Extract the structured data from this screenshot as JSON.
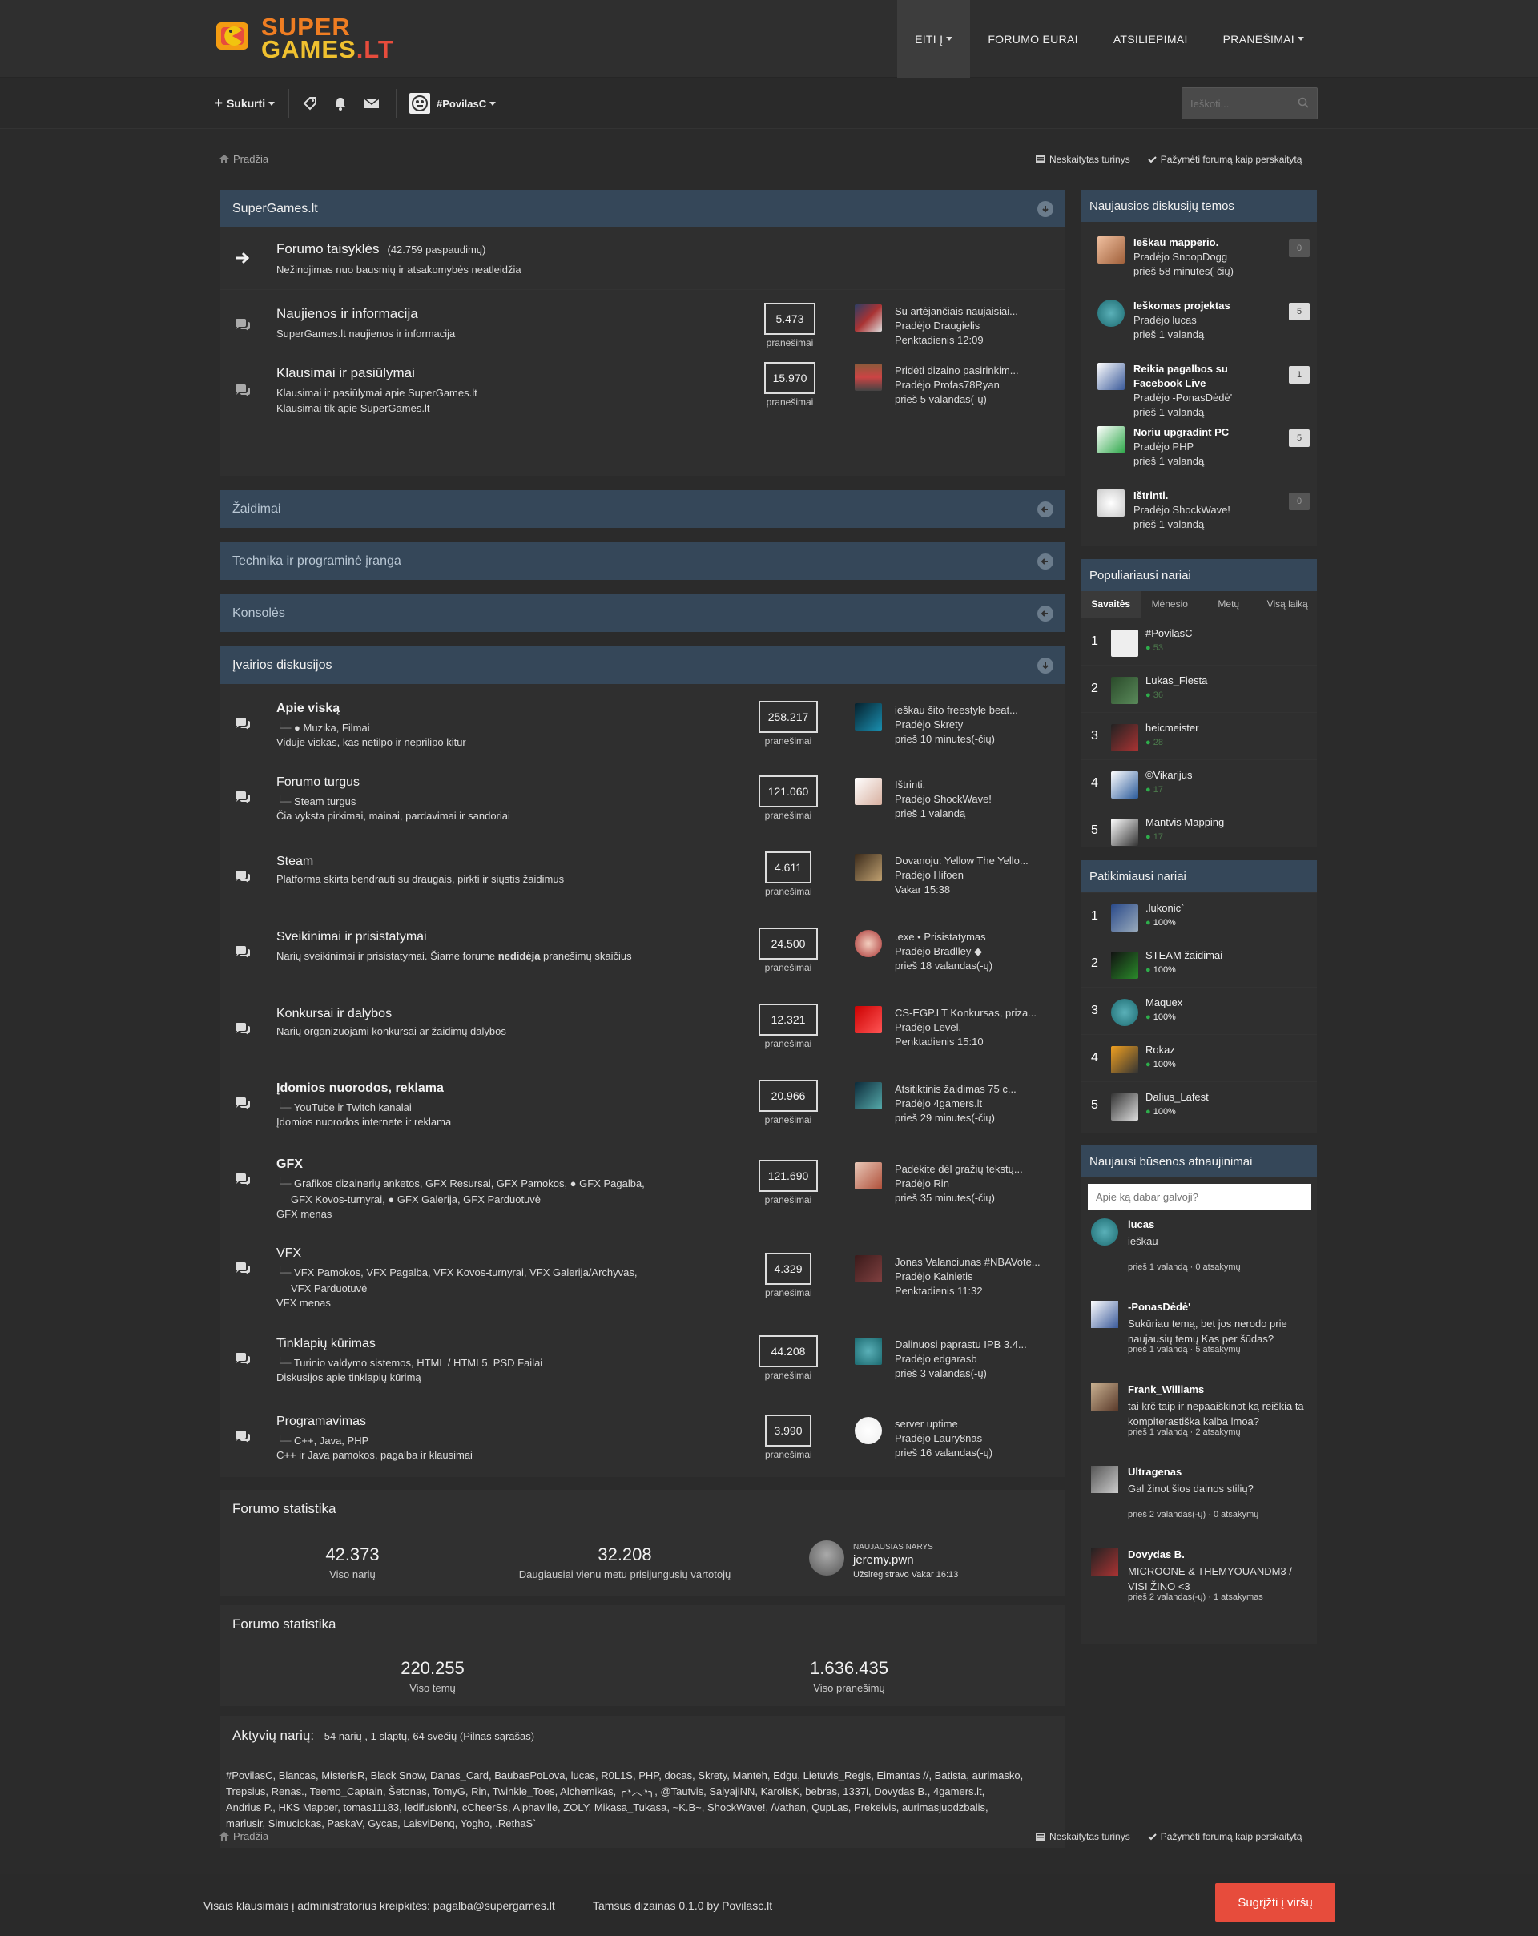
{
  "header": {
    "logo_line1": "SUPER",
    "logo_line2a": "GAMES",
    "logo_line2b": ".LT",
    "nav": [
      {
        "label": "EITI Į"
      },
      {
        "label": "FORUMO EURAI"
      },
      {
        "label": "ATSILIEPIMAI"
      },
      {
        "label": "PRANEŠIMAI"
      }
    ]
  },
  "userbar": {
    "create_label": "Sukurti",
    "username": "#PovilasC",
    "search_placeholder": "Ieškoti..."
  },
  "breadcrumb": {
    "home": "Pradžia",
    "unread": "Neskaitytas turinys",
    "mark_read": "Pažymėti forumą kaip perskaitytą"
  },
  "categories": [
    {
      "name": "SuperGames.lt",
      "forums": [
        {
          "title": "Forumo taisyklės",
          "views": "(42.759 paspaudimų)",
          "desc": "Nežinojimas nuo bausmių ir atsakomybės neatleidžia"
        },
        {
          "title": "Naujienos ir informacija",
          "desc": "SuperGames.lt naujienos ir informacija",
          "count": "5.473",
          "count_label": "pranešimai",
          "last_title": "Su artėjančiais naujaisiai...",
          "last_by": "Pradėjo Draugielis",
          "last_time": "Penktadienis 12:09"
        },
        {
          "title": "Klausimai ir pasiūlymai",
          "desc": "Klausimai ir pasiūlymai apie SuperGames.lt",
          "desc2": "Klausimai tik apie SuperGames.lt",
          "count": "15.970",
          "count_label": "pranešimai",
          "last_title": "Pridėti dizaino pasirinkim...",
          "last_by": "Pradėjo Profas78Ryan",
          "last_time": "prieš 5 valandas(-ų)"
        }
      ]
    },
    {
      "name": "Žaidimai"
    },
    {
      "name": "Technika ir programinė įranga"
    },
    {
      "name": "Konsolės"
    },
    {
      "name": "Įvairios diskusijos",
      "forums": [
        {
          "title": "Apie viską",
          "subs": "● Muzika,  Filmai",
          "desc": "Viduje viskas, kas netilpo ir neprilipo kitur",
          "count": "258.217",
          "count_label": "pranešimai",
          "last_title": "ieškau šito freestyle beat...",
          "last_by": "Pradėjo Skrety",
          "last_time": "prieš 10 minutes(-čių)"
        },
        {
          "title": "Forumo turgus",
          "subs": "Steam turgus",
          "desc": "Čia vyksta pirkimai, mainai, pardavimai ir sandoriai",
          "count": "121.060",
          "count_label": "pranešimai",
          "last_title": "Ištrinti.",
          "last_by": "Pradėjo ShockWave!",
          "last_time": "prieš 1 valandą"
        },
        {
          "title": "Steam",
          "desc": "Platforma skirta bendrauti su draugais, pirkti ir siųstis žaidimus",
          "count": "4.611",
          "count_label": "pranešimai",
          "last_title": "Dovanoju: Yellow The Yello...",
          "last_by": "Pradėjo Hifoen",
          "last_time": "Vakar 15:38"
        },
        {
          "title": "Sveikinimai ir prisistatymai",
          "desc_a": "Narių sveikinimai ir prisistatymai. Šiame forume ",
          "desc_b": "nedidėja",
          "desc_c": " pranešimų skaičius",
          "count": "24.500",
          "count_label": "pranešimai",
          "last_title": ".exe • Prisistatymas",
          "last_by": "Pradėjo Bradlley ◆",
          "last_time": "prieš 18 valandas(-ų)"
        },
        {
          "title": "Konkursai ir dalybos",
          "desc": "Narių organizuojami konkursai ar žaidimų dalybos",
          "count": "12.321",
          "count_label": "pranešimai",
          "last_title": "CS-EGP.LT Konkursas, priza...",
          "last_by": "Pradėjo Level.",
          "last_time": "Penktadienis 15:10"
        },
        {
          "title": "Įdomios nuorodos, reklama",
          "subs": "YouTube ir Twitch kanalai",
          "desc": "Įdomios nuorodos internete ir reklama",
          "count": "20.966",
          "count_label": "pranešimai",
          "last_title": "Atsitiktinis žaidimas 75 c...",
          "last_by": "Pradėjo 4gamers.lt",
          "last_time": "prieš 29 minutes(-čių)"
        },
        {
          "title": "GFX",
          "subs": "Grafikos dizainerių anketos,  GFX Resursai,  GFX Pamokos,  ● GFX Pagalba,",
          "subs2": "GFX Kovos-turnyrai,  ● GFX Galerija,  GFX Parduotuvė",
          "desc": "GFX menas",
          "count": "121.690",
          "count_label": "pranešimai",
          "last_title": "Padėkite dėl gražių tekstų...",
          "last_by": "Pradėjo Rin",
          "last_time": "prieš 35 minutes(-čių)"
        },
        {
          "title": "VFX",
          "subs": "VFX Pamokos,  VFX Pagalba,  VFX Kovos-turnyrai,  VFX Galerija/Archyvas,",
          "subs2": "VFX Parduotuvė",
          "desc": "VFX menas",
          "count": "4.329",
          "count_label": "pranešimai",
          "last_title": "Jonas Valanciunas #NBAVote...",
          "last_by": "Pradėjo Kalnietis",
          "last_time": "Penktadienis 11:32"
        },
        {
          "title": "Tinklapių kūrimas",
          "subs": "Turinio valdymo sistemos,  HTML / HTML5,  PSD Failai",
          "desc": "Diskusijos apie tinklapių kūrimą",
          "count": "44.208",
          "count_label": "pranešimai",
          "last_title": "Dalinuosi paprastu IPB 3.4...",
          "last_by": "Pradėjo edgarasb",
          "last_time": "prieš 3 valandas(-ų)"
        },
        {
          "title": "Programavimas",
          "subs": "C++,  Java,  PHP",
          "desc": "C++ ir Java pamokos, pagalba ir klausimai",
          "count": "3.990",
          "count_label": "pranešimai",
          "last_title": "server uptime",
          "last_by": "Pradėjo Laury8nas",
          "last_time": "prieš 16 valandas(-ų)"
        }
      ]
    }
  ],
  "stats1": {
    "title": "Forumo statistika",
    "members": "42.373",
    "members_label": "Viso narių",
    "max_online": "32.208",
    "max_online_label": "Daugiausiai vienu metu prisijungusių vartotojų",
    "newest_label": "NAUJAUSIAS NARYS",
    "newest_name": "jeremy.pwn",
    "newest_time": "Užsiregistravo Vakar 16:13"
  },
  "stats2": {
    "title": "Forumo statistika",
    "topics": "220.255",
    "topics_label": "Viso temų",
    "posts": "1.636.435",
    "posts_label": "Viso pranešimų"
  },
  "active": {
    "title": "Aktyvių narių:",
    "summary": "54 narių , 1 slaptų, 64 svečių (Pilnas sąrašas)",
    "line1": "#PovilasC, Blancas, MisterisR, Black Snow, Danas_Card, BaubasPoLova, lucas, R0L1S, PHP, docas, Skrety, Manteh, Edgu, Lietuvis_Regis, Eimantas //, Batista, aurimasko,",
    "line2": "Trepsius, Renas., Teemo_Captain, Šetonas, TomyG, Rin, Twinkle_Toes, Alchemikas, ╭◔︿◔╮, @Tautvis, SaiyajiNN, KarolisK, bebras, 1337i, Dovydas B., 4gamers.lt,",
    "line3": "Andrius P., HKS Mapper, tomas11183, ledifusionN, cCheerSs, Alphaville, ZOLY, Mikasa_Tukasa, ~K.B~, ShockWave!, /\\/athan, QupLas, Prekeivis, aurimasjuodzbalis,",
    "line4": "mariusir, Simuciokas, PaskaV, Gycas, LaisviDenq, Yogho, .RethaS`"
  },
  "sidebar": {
    "discussions_title": "Naujausios diskusijų temos",
    "discussions": [
      {
        "title": "Ieškau mapperio.",
        "by": "Pradėjo SnoopDogg",
        "time": "prieš 58 minutes(-čių)",
        "count": "0"
      },
      {
        "title": "Ieškomas projektas",
        "by": "Pradėjo lucas",
        "time": "prieš 1 valandą",
        "count": "5"
      },
      {
        "title": "Reikia pagalbos su",
        "title2": "Facebook Live",
        "by": "Pradėjo -PonasDėdė'",
        "time": "prieš 1 valandą",
        "count": "1"
      },
      {
        "title": "Noriu upgradint PC",
        "by": "Pradėjo PHP",
        "time": "prieš 1 valandą",
        "count": "5"
      },
      {
        "title": "Ištrinti.",
        "by": "Pradėjo ShockWave!",
        "time": "prieš 1 valandą",
        "count": "0"
      }
    ],
    "popular_title": "Populiariausi nariai",
    "popular_tabs": [
      "Savaitės",
      "Mėnesio",
      "Metų",
      "Visą laiką"
    ],
    "popular": [
      {
        "rank": "1",
        "name": "#PovilasC",
        "score": "53"
      },
      {
        "rank": "2",
        "name": "Lukas_Fiesta",
        "score": "36"
      },
      {
        "rank": "3",
        "name": "heicmeister",
        "score": "28"
      },
      {
        "rank": "4",
        "name": "©Vikarijus",
        "score": "17"
      },
      {
        "rank": "5",
        "name": "Mantvis Mapping",
        "score": "17"
      }
    ],
    "trusted_title": "Patikimiausi nariai",
    "trusted": [
      {
        "rank": "1",
        "name": ".lukonic`",
        "score": "100%"
      },
      {
        "rank": "2",
        "name": "STEAM žaidimai",
        "score": "100%"
      },
      {
        "rank": "3",
        "name": "Maquex",
        "score": "100%"
      },
      {
        "rank": "4",
        "name": "Rokaz",
        "score": "100%"
      },
      {
        "rank": "5",
        "name": "Dalius_Lafest",
        "score": "100%"
      }
    ],
    "status_title": "Naujausi būsenos atnaujinimai",
    "status_placeholder": "Apie ką dabar galvoji?",
    "statuses": [
      {
        "name": "lucas",
        "text": "ieškau",
        "meta": "prieš 1 valandą · 0 atsakymų"
      },
      {
        "name": "-PonasDėdė'",
        "text": "Sukūriau temą, bet jos nerodo prie naujausių temų Kas per šūdas?",
        "meta": "prieš 1 valandą · 5 atsakymų"
      },
      {
        "name": "Frank_Williams",
        "text": "tai krč taip ir nepaaiškinot ką reiškia ta kompiterastiška kalba lmoa?",
        "meta": "prieš 1 valandą · 2 atsakymų"
      },
      {
        "name": "Ultragenas",
        "text": "Gal žinot šios dainos stilių?",
        "meta": "prieš 2 valandas(-ų) · 0 atsakymų"
      },
      {
        "name": "Dovydas B.",
        "text": "MICROONE & THEMYOUANDM3 / VISI ŽINO <3",
        "meta": "prieš 2 valandas(-ų) · 1 atsakymas"
      }
    ]
  },
  "footer": {
    "contact": "Visais klausimais į administratorius kreipkitės: pagalba@supergames.lt",
    "design": "Tamsus dizainas 0.1.0 by Povilasc.lt",
    "back_top": "Sugrįžti į viršų"
  },
  "colors": {
    "accent": "#e74c3c",
    "category_header": "#354759",
    "online_green": "#2eae4b"
  }
}
